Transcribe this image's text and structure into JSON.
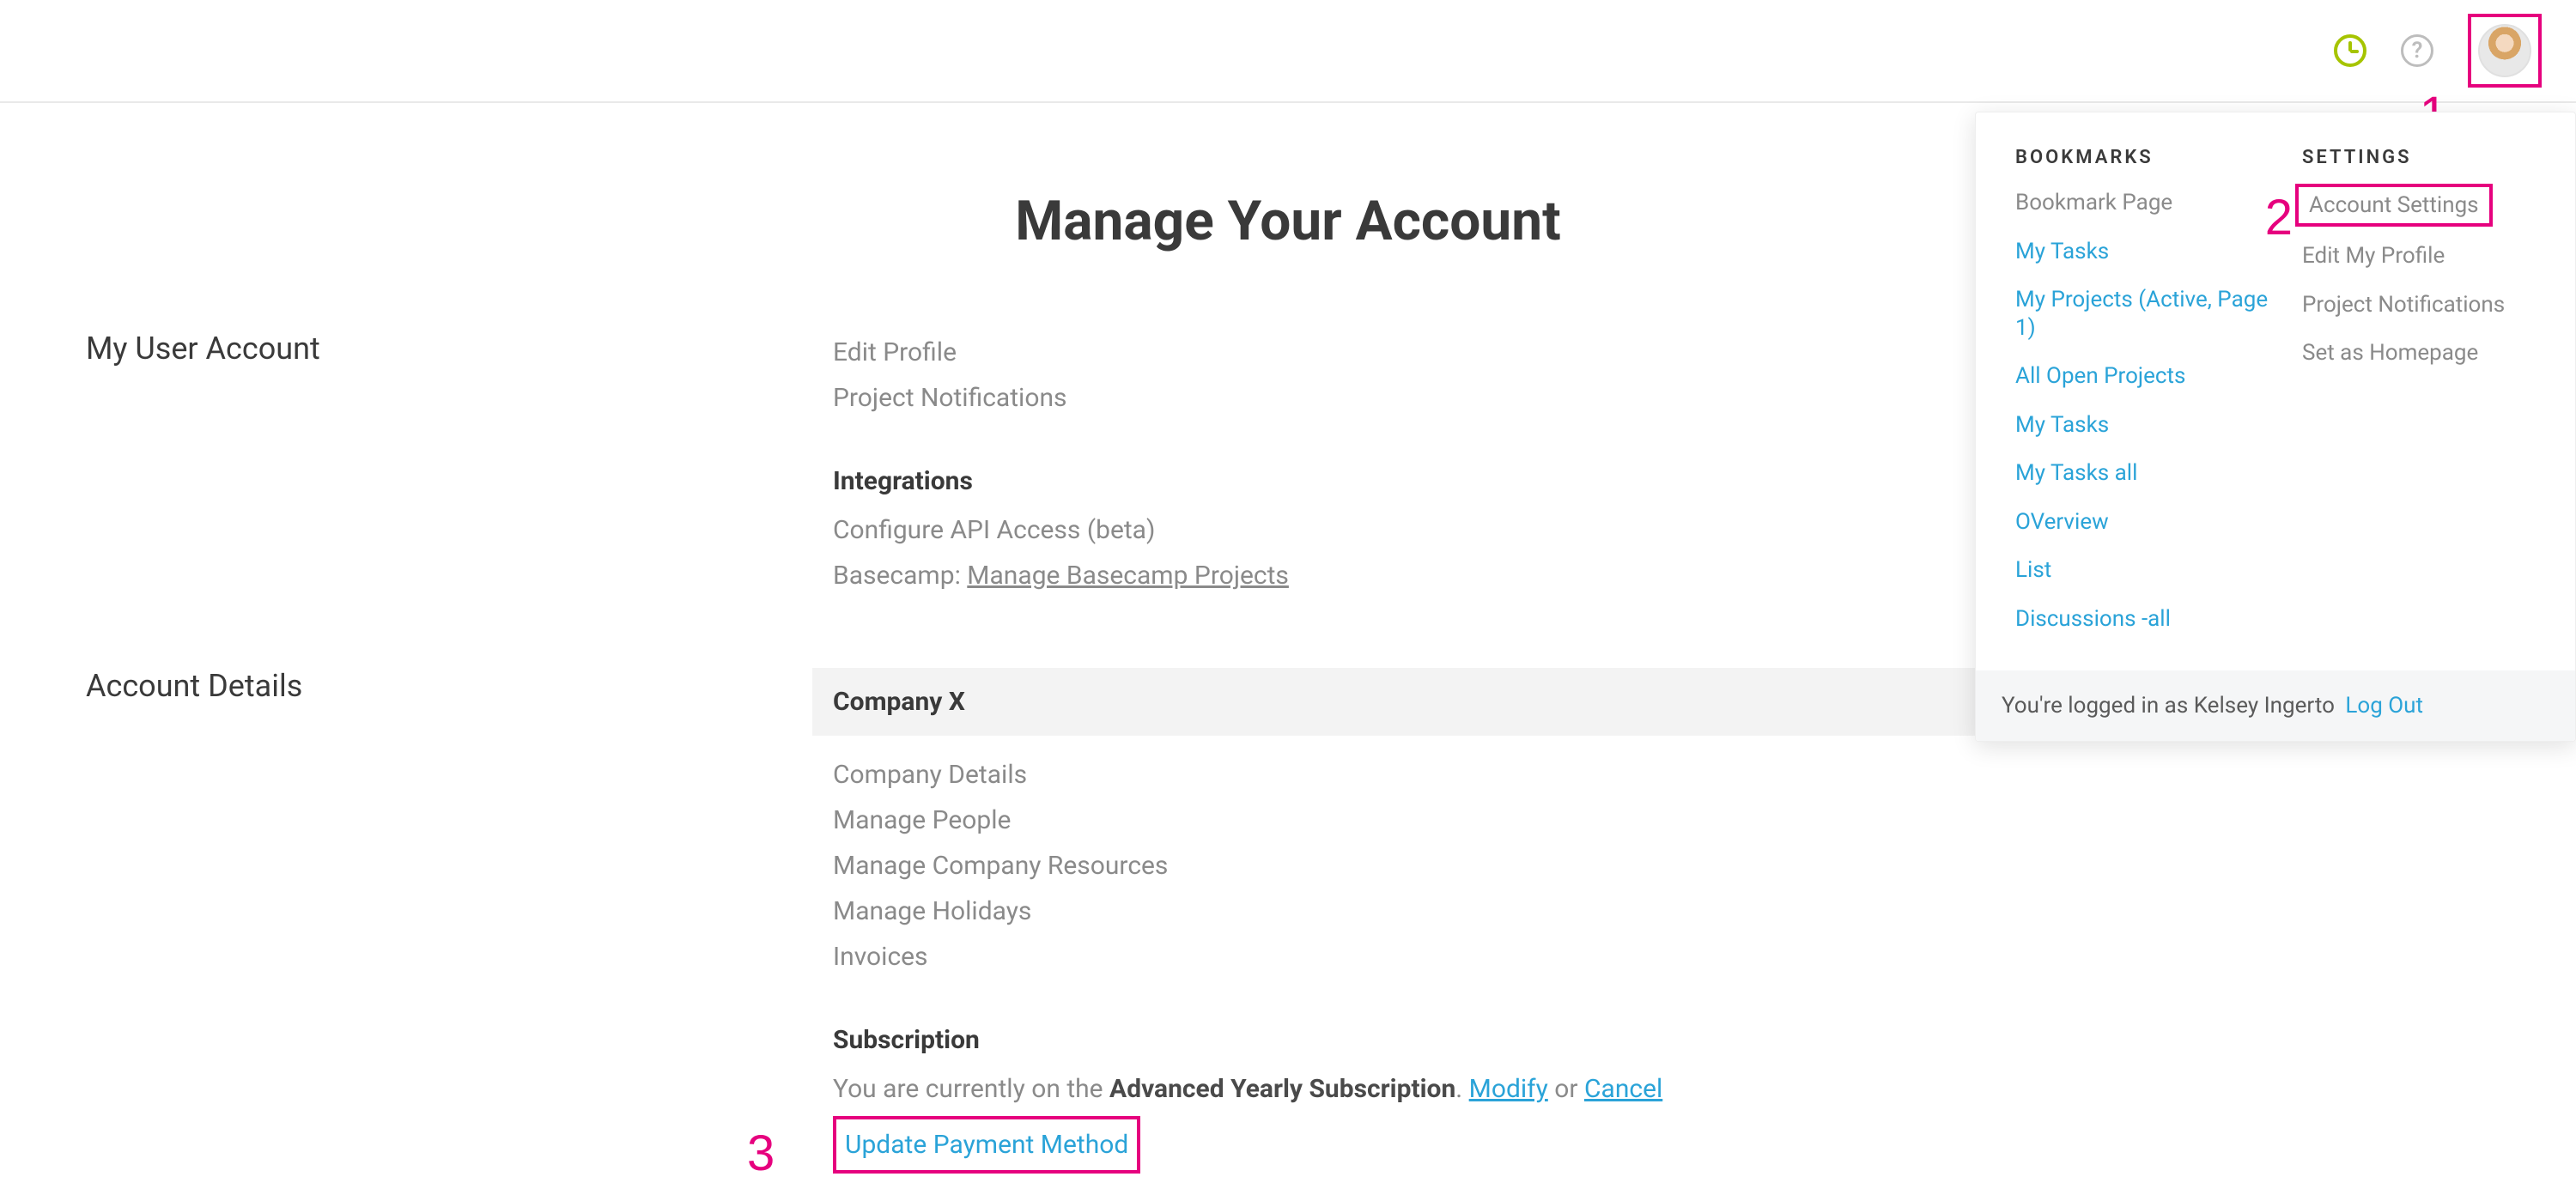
{
  "topbar": {
    "clock_icon": "clock-icon",
    "help_icon": "help-icon",
    "avatar": "user-avatar"
  },
  "annotations": {
    "one": "1",
    "two": "2",
    "three": "3"
  },
  "page": {
    "title": "Manage Your Account"
  },
  "user_account": {
    "label": "My User Account",
    "edit_profile": "Edit Profile",
    "project_notifications": "Project Notifications",
    "integrations_heading": "Integrations",
    "configure_api": "Configure API Access (beta)",
    "basecamp_prefix": "Basecamp: ",
    "basecamp_link": "Manage Basecamp Projects"
  },
  "account_details": {
    "label": "Account Details",
    "company_name": "Company X",
    "company_details": "Company Details",
    "manage_people": "Manage People",
    "manage_resources": "Manage Company Resources",
    "manage_holidays": "Manage Holidays",
    "invoices": "Invoices",
    "subscription_heading": "Subscription",
    "sub_prefix": "You are currently on the ",
    "plan_name": "Advanced Yearly Subscription",
    "period_after_plan": ". ",
    "modify": "Modify",
    "or_text": " or ",
    "cancel": "Cancel",
    "update_payment": "Update Payment Method"
  },
  "dropdown": {
    "bookmarks_heading": "BOOKMARKS",
    "settings_heading": "SETTINGS",
    "bookmark_page": "Bookmark Page",
    "my_tasks": "My Tasks",
    "my_projects": "My Projects (Active, Page 1)",
    "all_open_projects": "All Open Projects",
    "my_tasks2": "My Tasks",
    "my_tasks_all": "My Tasks all",
    "overview": "OVerview",
    "list": "List",
    "discussions": "Discussions -all",
    "account_settings": "Account Settings",
    "edit_my_profile": "Edit My Profile",
    "proj_notifications": "Project Notifications",
    "set_homepage": "Set as Homepage",
    "footer_prefix": "You're logged in as ",
    "footer_name": "Kelsey Ingerto",
    "logout": "Log Out"
  }
}
